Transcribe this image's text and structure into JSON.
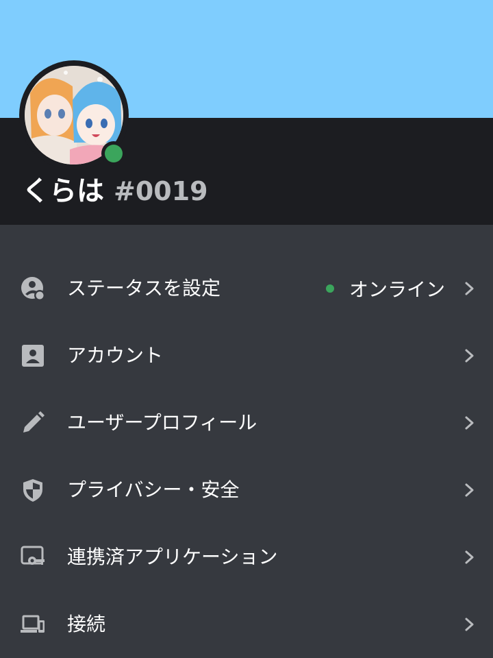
{
  "profile": {
    "username": "くらは",
    "discriminator": "#0019",
    "status_color": "#3ba55c"
  },
  "colors": {
    "banner": "#7fcdfe",
    "header": "#1c1d21",
    "background": "#36393f",
    "icon": "#b9bbbe"
  },
  "menu": {
    "items": [
      {
        "label": "ステータスを設定",
        "icon": "status-person-icon",
        "value": "オンライン"
      },
      {
        "label": "アカウント",
        "icon": "account-card-icon"
      },
      {
        "label": "ユーザープロフィール",
        "icon": "pencil-icon"
      },
      {
        "label": "プライバシー・安全",
        "icon": "shield-icon"
      },
      {
        "label": "連携済アプリケーション",
        "icon": "app-key-icon"
      },
      {
        "label": "接続",
        "icon": "devices-icon"
      }
    ]
  }
}
